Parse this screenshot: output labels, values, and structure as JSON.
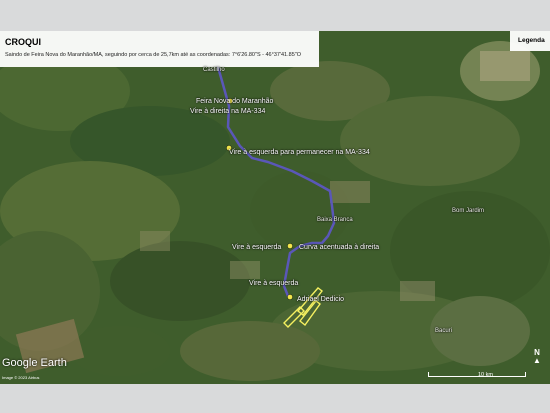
{
  "header": {
    "title": "CROQUI",
    "subtitle": "Saindo de Feira Nova do Maranhão/MA, seguindo por cerca de 25,7km até as coordenadas: 7°6'26.80\"S - 46°37'41.85\"O"
  },
  "legend": {
    "title": "Legenda"
  },
  "labels": {
    "town_top": "Castilho",
    "start": "Feira Nova do Maranhão",
    "instr1": "Vire à direita na MA-334",
    "instr2": "Vire à esquerda para permanecer na MA-334",
    "place_baixa": "Baixa Branca",
    "place_bom_jardim": "Bom Jardim",
    "instr3": "Vire à esquerda",
    "instr4": "Curva acentuada à direita",
    "instr5": "Vire à esquerda",
    "destination": "Adriael Dedicio",
    "place_bottom": "Bacuri"
  },
  "footer": {
    "logo_google": "Google",
    "logo_earth": "Earth",
    "credit": "Image © 2023 Airbus",
    "scale": "10 km",
    "north": "N"
  },
  "colors": {
    "route": "#5a57b8",
    "marker": "#f2e64d",
    "parcel": "#f5f060"
  }
}
